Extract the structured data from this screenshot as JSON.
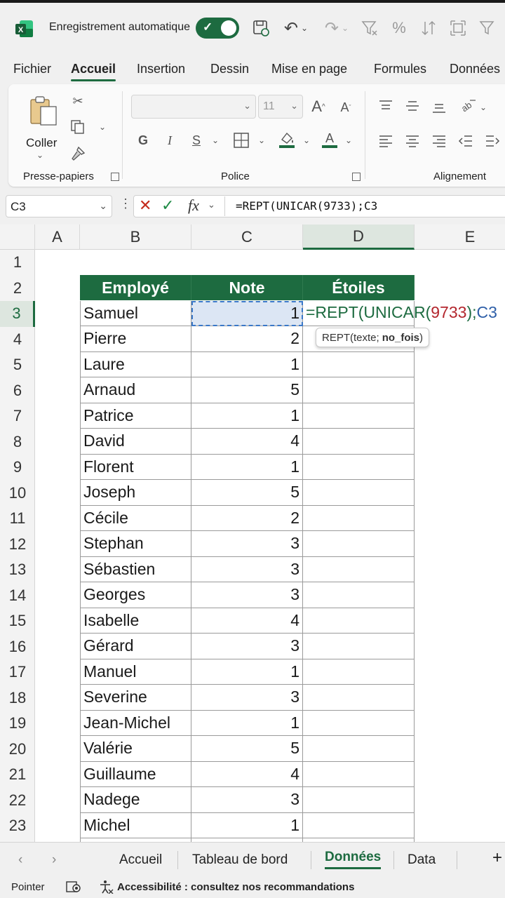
{
  "titlebar": {
    "autosave_label": "Enregistrement automatique",
    "autosave_on": true
  },
  "menu": {
    "tabs": [
      "Fichier",
      "Accueil",
      "Insertion",
      "Dessin",
      "Mise en page",
      "Formules",
      "Données"
    ],
    "active": "Accueil"
  },
  "ribbon": {
    "paste_label": "Coller",
    "clipboard_group": "Presse-papiers",
    "font_group": "Police",
    "font_size": "11",
    "bold": "G",
    "italic": "I",
    "underline": "S",
    "alignment_group": "Alignement"
  },
  "formula_bar": {
    "name_box": "C3",
    "formula": "=REPT(UNICAR(9733);C3"
  },
  "grid": {
    "columns": [
      "A",
      "B",
      "C",
      "D",
      "E"
    ],
    "selected_column": "D",
    "rows": [
      "1",
      "2",
      "3",
      "4",
      "5",
      "6",
      "7",
      "8",
      "9",
      "10",
      "11",
      "12",
      "13",
      "14",
      "15",
      "16",
      "17",
      "18",
      "19",
      "20",
      "21",
      "22",
      "23"
    ],
    "selected_row": "3"
  },
  "table": {
    "headers": [
      "Employé",
      "Note",
      "Étoiles"
    ],
    "rows": [
      {
        "name": "Samuel",
        "note": "1"
      },
      {
        "name": "Pierre",
        "note": "2"
      },
      {
        "name": "Laure",
        "note": "1"
      },
      {
        "name": "Arnaud",
        "note": "5"
      },
      {
        "name": "Patrice",
        "note": "1"
      },
      {
        "name": "David",
        "note": "4"
      },
      {
        "name": "Florent",
        "note": "1"
      },
      {
        "name": "Joseph",
        "note": "5"
      },
      {
        "name": "Cécile",
        "note": "2"
      },
      {
        "name": "Stephan",
        "note": "3"
      },
      {
        "name": "Sébastien",
        "note": "3"
      },
      {
        "name": "Georges",
        "note": "3"
      },
      {
        "name": "Isabelle",
        "note": "4"
      },
      {
        "name": "Gérard",
        "note": "3"
      },
      {
        "name": "Manuel",
        "note": "1"
      },
      {
        "name": "Severine",
        "note": "3"
      },
      {
        "name": "Jean-Michel",
        "note": "1"
      },
      {
        "name": "Valérie",
        "note": "5"
      },
      {
        "name": "Guillaume",
        "note": "4"
      },
      {
        "name": "Nadege",
        "note": "3"
      },
      {
        "name": "Michel",
        "note": "1"
      }
    ]
  },
  "edit": {
    "part_func": "=REPT(UNICAR(",
    "part_num": "9733",
    "part_close": ");",
    "part_ref": "C3",
    "tooltip_func": "REPT(texte; ",
    "tooltip_arg": "no_fois",
    "tooltip_close": ")"
  },
  "sheets": {
    "tabs": [
      "Accueil",
      "Tableau de bord",
      "Données",
      "Data"
    ],
    "active": "Données",
    "add": "+"
  },
  "status": {
    "mode": "Pointer",
    "accessibility": "Accessibilité : consultez nos recommandations"
  },
  "colors": {
    "accent": "#1d6b40",
    "formula_number": "#b3262d",
    "formula_ref": "#2e5fa8"
  }
}
